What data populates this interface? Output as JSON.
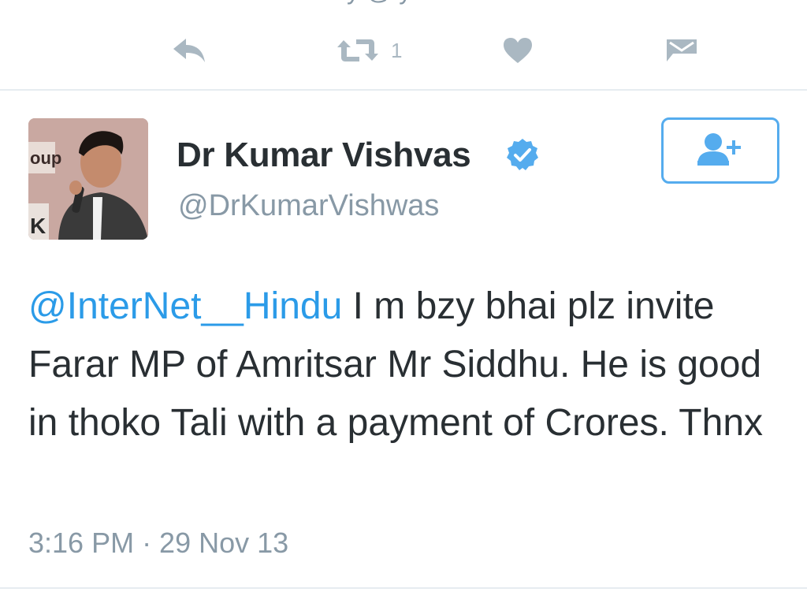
{
  "actions": {
    "retweet_count": "1",
    "reply_icon": "reply-icon",
    "retweet_icon": "retweet-icon",
    "like_icon": "heart-icon",
    "dm_icon": "envelope-icon"
  },
  "tweet": {
    "author_name": "Dr Kumar Vishvas",
    "handle": "@DrKumarVishwas",
    "verified": true,
    "mention": "@InterNet__Hindu",
    "body": " I m bzy bhai plz invite Farar MP of Amritsar Mr Siddhu. He is good in thoko Tali with a payment of Crores. Thnx",
    "timestamp": "3:16 PM · 29 Nov 13"
  },
  "follow_button": {
    "icon": "add-user-icon"
  },
  "colors": {
    "accent": "#55acee",
    "mention": "#2b9be8",
    "muted": "#8899a6",
    "icon_gray": "#aab8c2",
    "text": "#292f33"
  }
}
